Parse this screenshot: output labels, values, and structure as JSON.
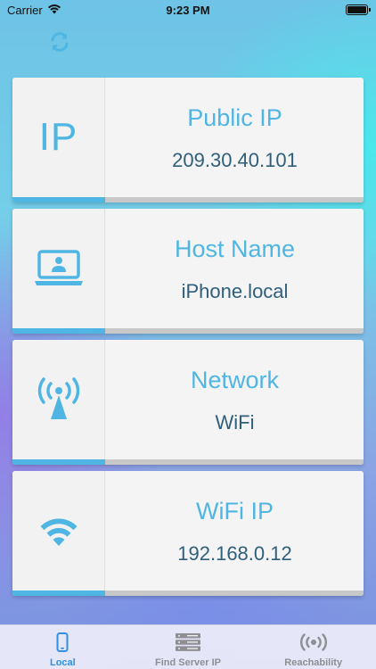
{
  "status_bar": {
    "carrier": "Carrier",
    "time": "9:23 PM"
  },
  "header": {
    "refresh_icon": "refresh-icon"
  },
  "cards": [
    {
      "icon": "ip-text-icon",
      "icon_text": "IP",
      "title": "Public IP",
      "value": "209.30.40.101"
    },
    {
      "icon": "laptop-user-icon",
      "title": "Host Name",
      "value": "iPhone.local"
    },
    {
      "icon": "antenna-icon",
      "title": "Network",
      "value": "WiFi"
    },
    {
      "icon": "wifi-icon",
      "title": "WiFi IP",
      "value": "192.168.0.12"
    }
  ],
  "tab_bar": {
    "tabs": [
      {
        "label": "Local",
        "icon": "phone-icon",
        "active": true
      },
      {
        "label": "Find Server IP",
        "icon": "server-icon",
        "active": false
      },
      {
        "label": "Reachability",
        "icon": "broadcast-icon",
        "active": false
      }
    ]
  },
  "colors": {
    "accent": "#4fb6e3",
    "value_text": "#2f5f7b",
    "tab_active": "#2f8fe0",
    "tab_inactive": "#8e8e93"
  }
}
